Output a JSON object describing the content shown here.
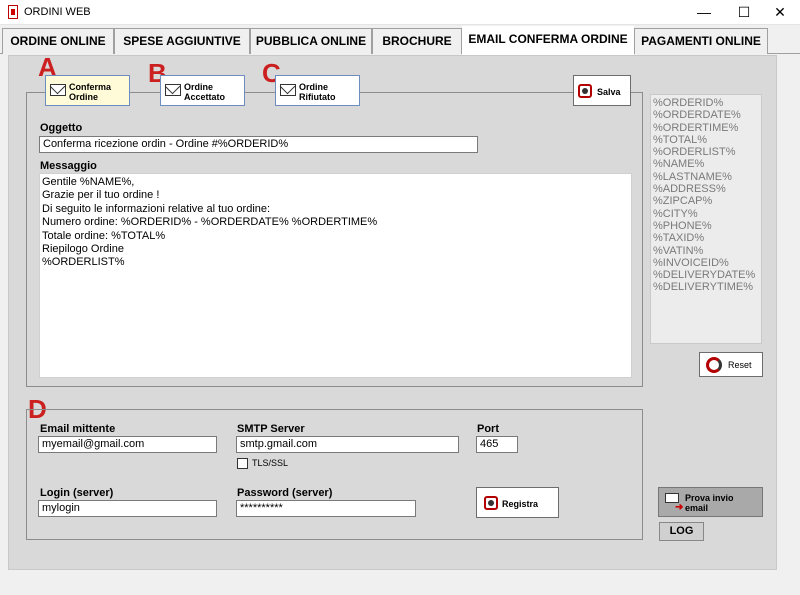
{
  "window": {
    "title": "ORDINI WEB",
    "minimize": "—",
    "maximize": "☐",
    "close": "✕"
  },
  "tabs": [
    {
      "label": "ORDINE ONLINE"
    },
    {
      "label": "SPESE AGGIUNTIVE"
    },
    {
      "label": "PUBBLICA ONLINE"
    },
    {
      "label": "BROCHURE"
    },
    {
      "label": "EMAIL CONFERMA ORDINE",
      "active": true
    },
    {
      "label": "PAGAMENTI ONLINE"
    }
  ],
  "annotations": {
    "a": "A",
    "b": "B",
    "c": "C",
    "d": "D"
  },
  "templates": {
    "conferma": {
      "line1": "Conferma",
      "line2": "Ordine"
    },
    "accettato": {
      "line1": "Ordine",
      "line2": "Accettato"
    },
    "rifiutato": {
      "line1": "Ordine",
      "line2": "Rifiutato"
    },
    "salva": "Salva"
  },
  "email": {
    "subject_label": "Oggetto",
    "subject_value": "Conferma ricezione ordin - Ordine #%ORDERID%",
    "message_label": "Messaggio",
    "message_lines": [
      "Gentile %NAME%,",
      "Grazie per il tuo ordine !",
      "Di seguito le informazioni relative al tuo ordine:",
      "Numero ordine: %ORDERID% - %ORDERDATE% %ORDERTIME%",
      "Totale ordine: %TOTAL%",
      "Riepilogo Ordine",
      "%ORDERLIST%"
    ]
  },
  "placeholders": [
    "%ORDERID%",
    "%ORDERDATE%",
    "%ORDERTIME%",
    "%TOTAL%",
    "%ORDERLIST%",
    "%NAME%",
    "%LASTNAME%",
    "%ADDRESS%",
    "%ZIPCAP%",
    "%CITY%",
    "%PHONE%",
    "%TAXID%",
    "%VATIN%",
    "%INVOICEID%",
    "%DELIVERYDATE%",
    "%DELIVERYTIME%"
  ],
  "reset_label": "Reset",
  "smtp": {
    "sender_label": "Email mittente",
    "sender_value": "myemail@gmail.com",
    "server_label": "SMTP Server",
    "server_value": "smtp.gmail.com",
    "port_label": "Port",
    "port_value": "465",
    "tls_label": "TLS/SSL",
    "tls_checked": false,
    "login_label": "Login (server)",
    "login_value": "mylogin",
    "password_label": "Password (server)",
    "password_value": "**********",
    "register_label": "Registra"
  },
  "test_send": {
    "line1": "Prova invio",
    "line2": "email"
  },
  "log_label": "LOG"
}
